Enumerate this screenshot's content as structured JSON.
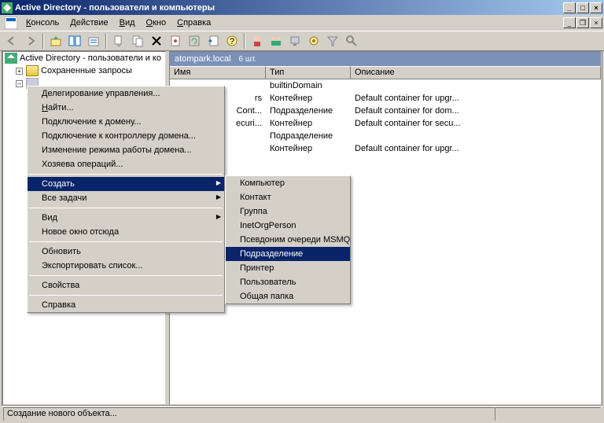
{
  "window": {
    "title": "Active Directory - пользователи и компьютеры"
  },
  "menubar": {
    "console": "Консоль",
    "action": "Действие",
    "view": "Вид",
    "window": "Окно",
    "help": "Справка"
  },
  "tree": {
    "root": "Active Directory - пользователи и ко",
    "saved_queries": "Сохраненные запросы"
  },
  "main": {
    "header_title": "atompark.local",
    "header_count": "6 шт.",
    "columns": {
      "name": "Имя",
      "type": "Тип",
      "desc": "Описание"
    },
    "col_widths": {
      "name": 122,
      "type": 108,
      "desc": 200
    },
    "rows": [
      {
        "name": "",
        "type": "builtinDomain",
        "desc": ""
      },
      {
        "name": "rs",
        "type": "Контейнер",
        "desc": "Default container for upgr..."
      },
      {
        "name": "Cont...",
        "type": "Подразделение",
        "desc": "Default container for dom..."
      },
      {
        "name": "ecuri...",
        "type": "Контейнер",
        "desc": "Default container for secu..."
      },
      {
        "name": "",
        "type": "Подразделение",
        "desc": ""
      },
      {
        "name": "",
        "type": "Контейнер",
        "desc": "Default container for upgr..."
      }
    ]
  },
  "context_menu": {
    "items": [
      {
        "label": "Делегирование управления...",
        "type": "item"
      },
      {
        "label": "Найти...",
        "type": "item",
        "u": 0
      },
      {
        "label": "Подключение к домену...",
        "type": "item"
      },
      {
        "label": "Подключение к контроллеру домена...",
        "type": "item"
      },
      {
        "label": "Изменение режима работы домена...",
        "type": "item"
      },
      {
        "label": "Хозяева операций...",
        "type": "item"
      },
      {
        "type": "sep"
      },
      {
        "label": "Создать",
        "type": "item",
        "highlighted": true,
        "submenu": true
      },
      {
        "label": "Все задачи",
        "type": "item",
        "submenu": true
      },
      {
        "type": "sep"
      },
      {
        "label": "Вид",
        "type": "item",
        "submenu": true
      },
      {
        "label": "Новое окно отсюда",
        "type": "item"
      },
      {
        "type": "sep"
      },
      {
        "label": "Обновить",
        "type": "item"
      },
      {
        "label": "Экспортировать список...",
        "type": "item"
      },
      {
        "type": "sep"
      },
      {
        "label": "Свойства",
        "type": "item"
      },
      {
        "type": "sep"
      },
      {
        "label": "Справка",
        "type": "item"
      }
    ]
  },
  "submenu": {
    "items": [
      {
        "label": "Компьютер"
      },
      {
        "label": "Контакт"
      },
      {
        "label": "Группа"
      },
      {
        "label": "InetOrgPerson"
      },
      {
        "label": "Псевдоним очереди MSMQ"
      },
      {
        "label": "Подразделение",
        "highlighted": true
      },
      {
        "label": "Принтер"
      },
      {
        "label": "Пользователь"
      },
      {
        "label": "Общая папка"
      }
    ]
  },
  "statusbar": {
    "text": "Создание нового объекта..."
  }
}
